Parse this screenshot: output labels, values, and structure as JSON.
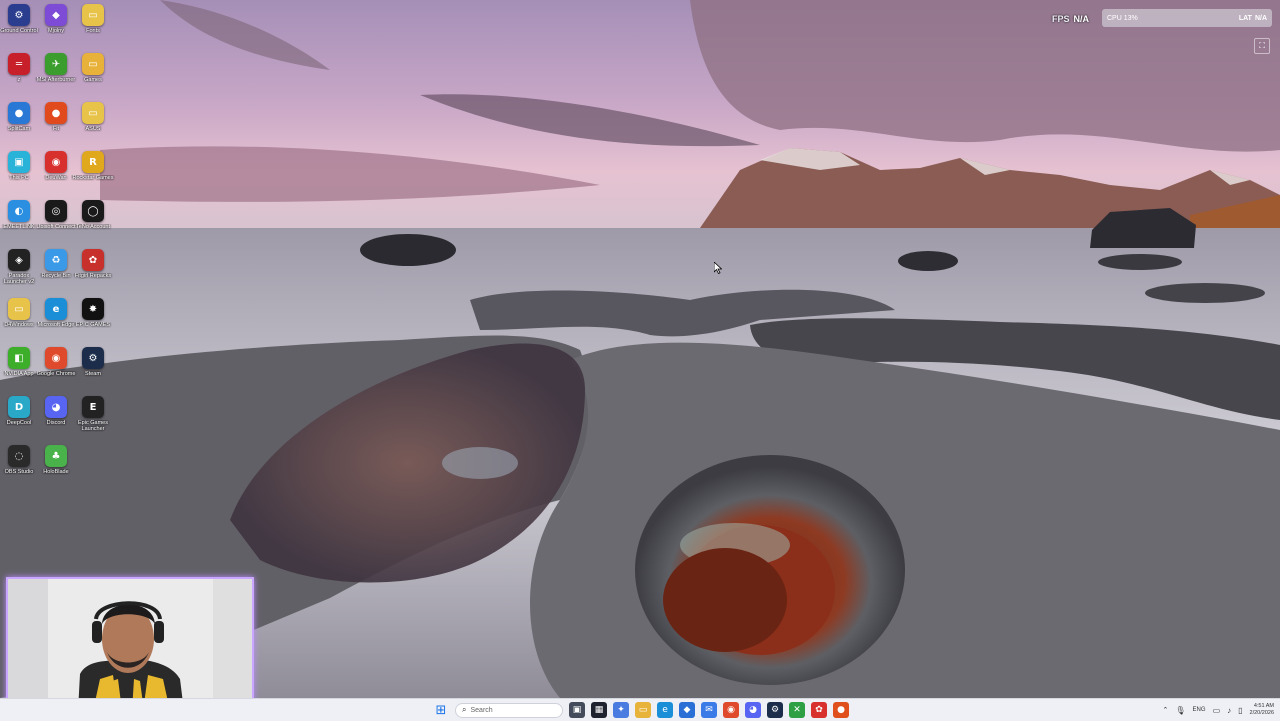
{
  "desktop": {
    "icons": [
      {
        "label": "Ground Control",
        "glyph": "⚙",
        "color": "#2b3d8f"
      },
      {
        "label": "Mjolny",
        "glyph": "◆",
        "color": "#7d4bd6"
      },
      {
        "label": "Fonts",
        "glyph": "▭",
        "color": "#e8c34a"
      },
      {
        "label": "z",
        "glyph": "═",
        "color": "#c8202a"
      },
      {
        "label": "MSI Afterburner",
        "glyph": "✈",
        "color": "#3a9d2e"
      },
      {
        "label": "Games",
        "glyph": "▭",
        "color": "#e8b13a"
      },
      {
        "label": "SplitCam",
        "glyph": "●",
        "color": "#2a78d6"
      },
      {
        "label": "Fit",
        "glyph": "●",
        "color": "#e04a1c"
      },
      {
        "label": "ASUS",
        "glyph": "▭",
        "color": "#e8c34a"
      },
      {
        "label": "This PC",
        "glyph": "▣",
        "color": "#2ab3d9"
      },
      {
        "label": "DeuWan",
        "glyph": "◉",
        "color": "#d8302c"
      },
      {
        "label": "Rockstar Games",
        "glyph": "R",
        "color": "#e0a81c"
      },
      {
        "label": "EMEETLINK",
        "glyph": "◐",
        "color": "#2a8fe0"
      },
      {
        "label": "Ubisoft Connect",
        "glyph": "◎",
        "color": "#1a1a1a"
      },
      {
        "label": "TeNo Account",
        "glyph": "◯",
        "color": "#1a1a1a"
      },
      {
        "label": "Paradox Launcher v2",
        "glyph": "◈",
        "color": "#222222"
      },
      {
        "label": "Recycle Bin",
        "glyph": "♻",
        "color": "#3a9ae8"
      },
      {
        "label": "Fitgirl Repacks",
        "glyph": "✿",
        "color": "#c8302c"
      },
      {
        "label": "D4Windows",
        "glyph": "▭",
        "color": "#e8c34a"
      },
      {
        "label": "Microsoft Edge",
        "glyph": "e",
        "color": "#1a8fd8"
      },
      {
        "label": "EPIC GAMES",
        "glyph": "✸",
        "color": "#111111"
      },
      {
        "label": "NVIDIA App",
        "glyph": "◧",
        "color": "#3cae2a"
      },
      {
        "label": "Google Chrome",
        "glyph": "◉",
        "color": "#e04a2c"
      },
      {
        "label": "Steam",
        "glyph": "⚙",
        "color": "#1b2d4a"
      },
      {
        "label": "DeepCool",
        "glyph": "D",
        "color": "#2aa8c8"
      },
      {
        "label": "Discord",
        "glyph": "◕",
        "color": "#5865f2"
      },
      {
        "label": "Epic Games Launcher",
        "glyph": "E",
        "color": "#222222"
      },
      {
        "label": "OBS Studio",
        "glyph": "◌",
        "color": "#2a2a2a"
      },
      {
        "label": "HoloBlade",
        "glyph": "♣",
        "color": "#4ab24a"
      }
    ]
  },
  "overlay": {
    "fps_label": "FPS",
    "fps_value": "N/A",
    "perf_text": "CPU 13%",
    "lat_label": "LAT",
    "lat_value": "N/A",
    "corner_glyph": "⛶"
  },
  "taskbar": {
    "start_glyph": "⊞",
    "search_placeholder": "Search",
    "apps": [
      {
        "name": "task-view",
        "glyph": "▣",
        "color": "#444c5c"
      },
      {
        "name": "app-dark",
        "glyph": "▦",
        "color": "#1f2330"
      },
      {
        "name": "app-copilot",
        "glyph": "✦",
        "color": "#4a7be0"
      },
      {
        "name": "file-explorer",
        "glyph": "▭",
        "color": "#e8b33a"
      },
      {
        "name": "edge",
        "glyph": "e",
        "color": "#1a8fd8"
      },
      {
        "name": "store",
        "glyph": "◆",
        "color": "#2a6fd6"
      },
      {
        "name": "mail",
        "glyph": "✉",
        "color": "#3a7be8"
      },
      {
        "name": "chrome",
        "glyph": "◉",
        "color": "#e04a2c"
      },
      {
        "name": "discord",
        "glyph": "◕",
        "color": "#5865f2"
      },
      {
        "name": "steam",
        "glyph": "⚙",
        "color": "#1b2d4a"
      },
      {
        "name": "xbox",
        "glyph": "✕",
        "color": "#2ea043"
      },
      {
        "name": "app-red",
        "glyph": "✿",
        "color": "#d8302c"
      },
      {
        "name": "app-orange",
        "glyph": "●",
        "color": "#e0501c"
      }
    ],
    "lang": "ENG",
    "time": "4:51 AM",
    "date": "2/20/2026"
  }
}
